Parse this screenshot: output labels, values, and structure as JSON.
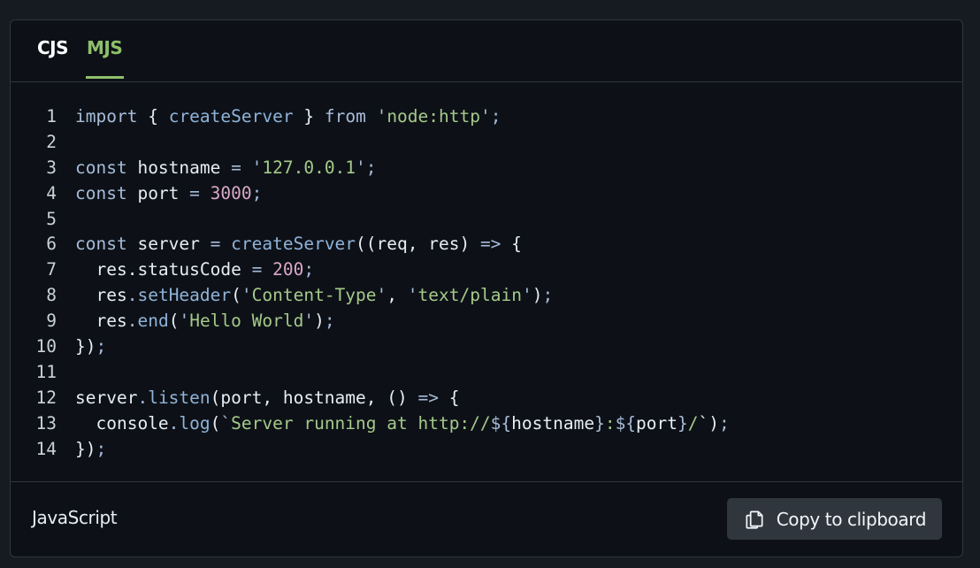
{
  "tabs": [
    {
      "label": "CJS",
      "active": false
    },
    {
      "label": "MJS",
      "active": true
    }
  ],
  "code": {
    "line_numbers": [
      "1",
      "2",
      "3",
      "4",
      "5",
      "6",
      "7",
      "8",
      "9",
      "10",
      "11",
      "12",
      "13",
      "14"
    ]
  },
  "footer": {
    "language": "JavaScript",
    "copy_label": "Copy to clipboard",
    "copy_icon": "copy-icon"
  },
  "colors": {
    "background": "#0d1117",
    "active_tab": "#8fbf6a",
    "string": "#a5c98a",
    "number": "#d9a7c8",
    "keyword": "#a7bcd9",
    "button": "#30363d"
  }
}
